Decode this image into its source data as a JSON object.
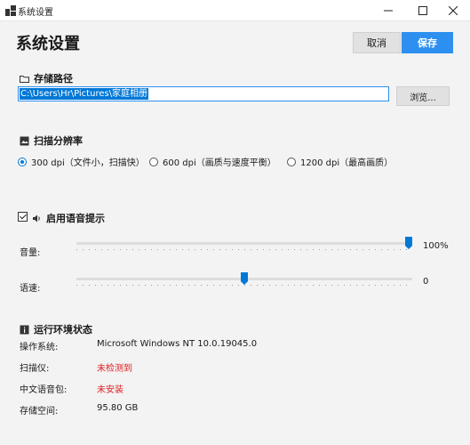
{
  "window": {
    "title": "系统设置",
    "minimize_icon": "minimize-icon",
    "maximize_icon": "maximize-icon",
    "close_icon": "close-icon"
  },
  "header": {
    "title": "系统设置",
    "cancel_label": "取消",
    "save_label": "保存",
    "accent": "#2d8ff0"
  },
  "storage": {
    "title": "存储路径",
    "icon": "folder-icon",
    "path_value": "C:\\Users\\Hr\\Pictures\\家庭相册",
    "browse_label": "浏览..."
  },
  "resolution": {
    "title": "扫描分辨率",
    "icon": "image-icon",
    "selected": 0,
    "options": [
      {
        "label": "300 dpi（文件小，扫描快）"
      },
      {
        "label": "600 dpi（画质与速度平衡）"
      },
      {
        "label": "1200 dpi（最高画质）"
      }
    ]
  },
  "voice": {
    "enabled": true,
    "title": "启用语音提示",
    "icon": "speaker-icon",
    "volume_label": "音量:",
    "volume_value": "100%",
    "volume_fraction": 1.0,
    "speed_label": "语速:",
    "speed_value": "0",
    "speed_fraction": 0.5
  },
  "environment": {
    "title": "运行环境状态",
    "icon": "info-icon",
    "error_color": "#e02020",
    "rows": [
      {
        "key": "操作系统:",
        "value": "Microsoft Windows NT 10.0.19045.0",
        "status": "normal"
      },
      {
        "key": "扫描仪:",
        "value": "未检测到",
        "status": "error"
      },
      {
        "key": "中文语音包:",
        "value": "未安装",
        "status": "error"
      },
      {
        "key": "存储空间:",
        "value": "95.80 GB",
        "status": "normal"
      }
    ]
  }
}
